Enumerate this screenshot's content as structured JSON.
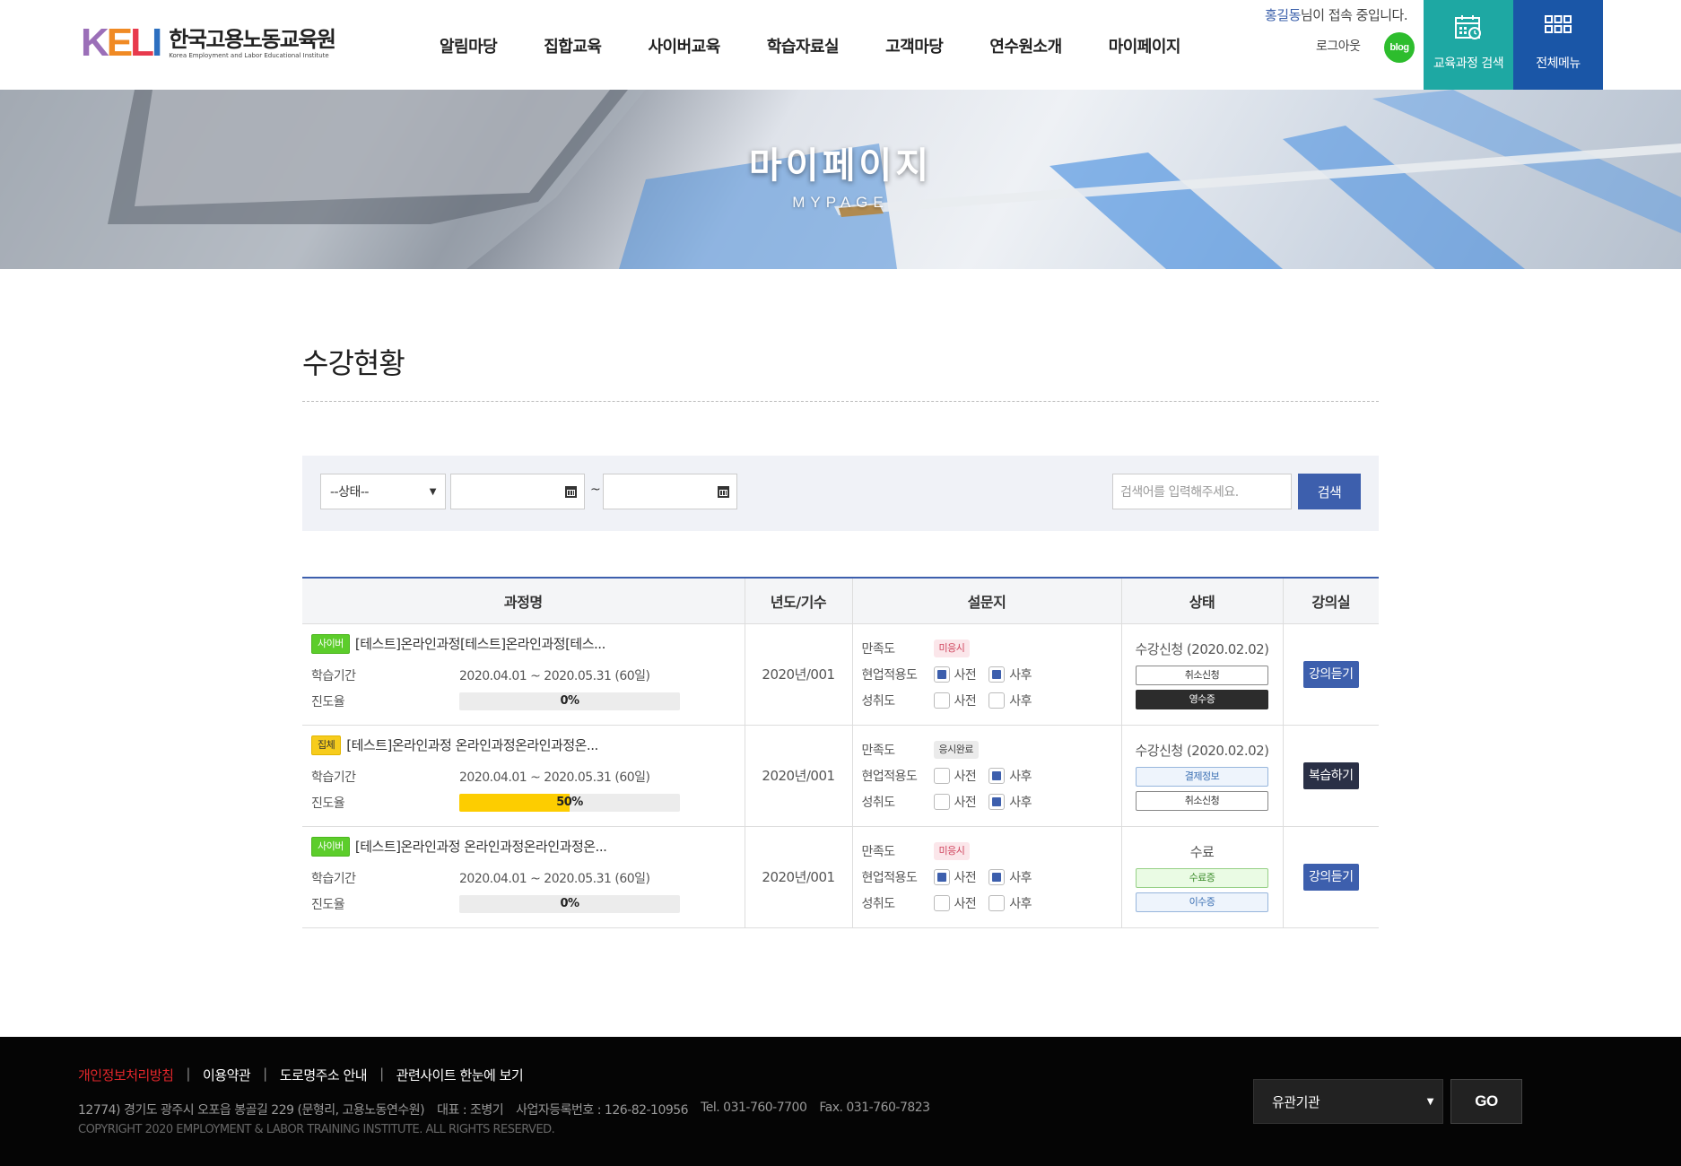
{
  "header": {
    "logo_mark": "KELI",
    "logo_ko": "한국고용노동교육원",
    "logo_en": "Korea Employment and Labor Educational Institute",
    "nav": [
      "알림마당",
      "집합교육",
      "사이버교육",
      "학습자료실",
      "고객마당",
      "연수원소개",
      "마이페이지"
    ],
    "user_name": "홍길동",
    "welcome_suffix": "님이 접속 중입니다.",
    "logout_label": "로그아웃",
    "blog_label": "blog",
    "course_search_label": "교육과정 검색",
    "all_menu_label": "전체메뉴",
    "colors": {
      "course_tile": "#1ea8a3",
      "menu_tile": "#1a56a7",
      "blog": "#2dbd2d"
    }
  },
  "banner": {
    "title": "마이페이지",
    "subtitle": "MYPAGE"
  },
  "page_title": "수강현황",
  "search": {
    "status_selected": "--상태--",
    "date_separator": "~",
    "keyword_placeholder": "검색어를 입력해주세요.",
    "button_label": "검색"
  },
  "table": {
    "headers": [
      "과정명",
      "년도/기수",
      "설문지",
      "상태",
      "강의실"
    ],
    "labels": {
      "period": "학습기간",
      "progress": "진도율",
      "satisfaction": "만족도",
      "applicability": "현업적용도",
      "achievement": "성취도",
      "pre": "사전",
      "post": "사후"
    },
    "rows": [
      {
        "type_badge": "사이버",
        "type": "cyber",
        "title": "[테스트]온라인과정[테스트]온라인과정[테스...",
        "period": "2020.04.01 ~ 2020.05.31 (60일)",
        "progress": 0,
        "progress_label": "0%",
        "year_term": "2020년/001",
        "satisfaction_badge": "미응시",
        "satisfaction_done": false,
        "applicability_pre": true,
        "applicability_post": true,
        "achievement_pre": false,
        "achievement_post": false,
        "status_text": "수강신청 (2020.02.02)",
        "status_buttons": [
          {
            "label": "취소신청",
            "style": "outline"
          },
          {
            "label": "영수증",
            "style": "dark"
          }
        ],
        "room_button": "강의듣기",
        "room_style": "blue"
      },
      {
        "type_badge": "집체",
        "type": "group",
        "title": "[테스트]온라인과정 온라인과정온라인과정온...",
        "period": "2020.04.01 ~ 2020.05.31 (60일)",
        "progress": 50,
        "progress_label": "50%",
        "year_term": "2020년/001",
        "satisfaction_badge": "응시완료",
        "satisfaction_done": true,
        "applicability_pre": false,
        "applicability_post": true,
        "achievement_pre": false,
        "achievement_post": true,
        "status_text": "수강신청 (2020.02.02)",
        "status_buttons": [
          {
            "label": "결제정보",
            "style": "blueline"
          },
          {
            "label": "취소신청",
            "style": "outline"
          }
        ],
        "room_button": "복습하기",
        "room_style": "dark"
      },
      {
        "type_badge": "사이버",
        "type": "cyber",
        "title": "[테스트]온라인과정 온라인과정온라인과정온...",
        "period": "2020.04.01 ~ 2020.05.31 (60일)",
        "progress": 0,
        "progress_label": "0%",
        "year_term": "2020년/001",
        "satisfaction_badge": "미응시",
        "satisfaction_done": false,
        "applicability_pre": true,
        "applicability_post": true,
        "achievement_pre": false,
        "achievement_post": false,
        "status_text": "수료",
        "status_buttons": [
          {
            "label": "수료증",
            "style": "greenline"
          },
          {
            "label": "이수증",
            "style": "blueline"
          }
        ],
        "room_button": "강의듣기",
        "room_style": "blue"
      }
    ]
  },
  "footer": {
    "links": [
      "개인정보처리방침",
      "이용약관",
      "도로명주소 안내",
      "관련사이트 한눈에 보기"
    ],
    "address": "12774) 경기도 광주시 오포읍 봉골길 229 (문형리, 고용노동연수원)",
    "ceo": "대표 : 조병기",
    "biz_no": "사업자등록번호 : 126-82-10956",
    "tel": "Tel. 031-760-7700",
    "fax": "Fax. 031-760-7823",
    "copyright": "COPYRIGHT 2020 EMPLOYMENT & LABOR TRAINING INSTITUTE. ALL RIGHTS RESERVED.",
    "family_select": "유관기관",
    "go_label": "GO"
  }
}
